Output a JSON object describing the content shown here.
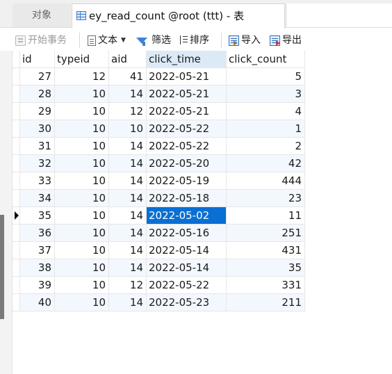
{
  "tabs": {
    "objects_label": "对象",
    "active_label": "ey_read_count @root (ttt) - 表"
  },
  "toolbar": {
    "begin_transaction": "开始事务",
    "text": "文本",
    "filter": "筛选",
    "sort": "排序",
    "import": "导入",
    "export": "导出"
  },
  "table": {
    "columns": [
      "id",
      "typeid",
      "aid",
      "click_time",
      "click_count"
    ],
    "sorted_column": "click_time",
    "selected_cell": {
      "row_index": 8,
      "column": "click_time"
    },
    "rows": [
      {
        "id": "27",
        "typeid": "12",
        "aid": "41",
        "click_time": "2022-05-21",
        "click_count": "5"
      },
      {
        "id": "28",
        "typeid": "10",
        "aid": "14",
        "click_time": "2022-05-21",
        "click_count": "3"
      },
      {
        "id": "29",
        "typeid": "10",
        "aid": "12",
        "click_time": "2022-05-21",
        "click_count": "4"
      },
      {
        "id": "30",
        "typeid": "10",
        "aid": "10",
        "click_time": "2022-05-22",
        "click_count": "1"
      },
      {
        "id": "31",
        "typeid": "10",
        "aid": "14",
        "click_time": "2022-05-22",
        "click_count": "2"
      },
      {
        "id": "32",
        "typeid": "10",
        "aid": "14",
        "click_time": "2022-05-20",
        "click_count": "42"
      },
      {
        "id": "33",
        "typeid": "10",
        "aid": "14",
        "click_time": "2022-05-19",
        "click_count": "444"
      },
      {
        "id": "34",
        "typeid": "10",
        "aid": "14",
        "click_time": "2022-05-18",
        "click_count": "23"
      },
      {
        "id": "35",
        "typeid": "10",
        "aid": "14",
        "click_time": "2022-05-02",
        "click_count": "11"
      },
      {
        "id": "36",
        "typeid": "10",
        "aid": "14",
        "click_time": "2022-05-16",
        "click_count": "251"
      },
      {
        "id": "37",
        "typeid": "10",
        "aid": "14",
        "click_time": "2022-05-14",
        "click_count": "431"
      },
      {
        "id": "38",
        "typeid": "10",
        "aid": "14",
        "click_time": "2022-05-14",
        "click_count": "35"
      },
      {
        "id": "39",
        "typeid": "10",
        "aid": "12",
        "click_time": "2022-05-22",
        "click_count": "331"
      },
      {
        "id": "40",
        "typeid": "10",
        "aid": "14",
        "click_time": "2022-05-23",
        "click_count": "211"
      }
    ]
  },
  "colors": {
    "selection": "#0a6fd3",
    "sorted_header": "#dceaf8",
    "accent_icon": "#3c82d6"
  }
}
